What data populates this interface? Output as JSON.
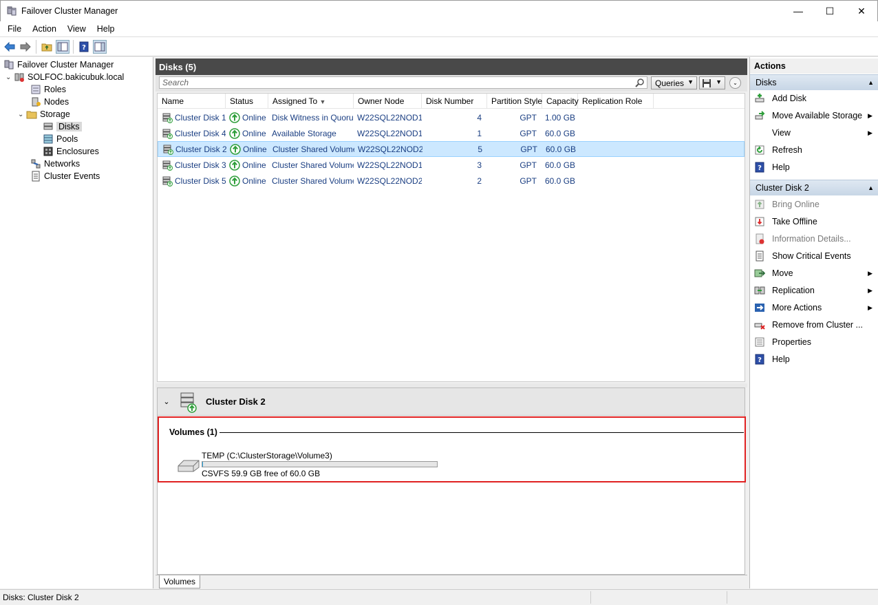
{
  "window": {
    "title": "Failover Cluster Manager",
    "minimize": "—",
    "maximize": "☐",
    "close": "✕"
  },
  "menu": [
    "File",
    "Action",
    "View",
    "Help"
  ],
  "tree": {
    "root": "Failover Cluster Manager",
    "cluster": "SOLFOC.bakicubuk.local",
    "roles": "Roles",
    "nodes": "Nodes",
    "storage": "Storage",
    "disks": "Disks",
    "pools": "Pools",
    "enclosures": "Enclosures",
    "networks": "Networks",
    "events": "Cluster Events"
  },
  "center": {
    "header": "Disks (5)",
    "search_placeholder": "Search",
    "queries": "Queries",
    "columns": [
      "Name",
      "Status",
      "Assigned To",
      "Owner Node",
      "Disk Number",
      "Partition Style",
      "Capacity",
      "Replication Role"
    ],
    "rows": [
      {
        "name": "Cluster Disk 1",
        "status": "Online",
        "assigned": "Disk Witness in Quorum",
        "owner": "W22SQL22NOD1",
        "number": "4",
        "style": "GPT",
        "capacity": "1.00 GB",
        "role": ""
      },
      {
        "name": "Cluster Disk 4",
        "status": "Online",
        "assigned": "Available Storage",
        "owner": "W22SQL22NOD1",
        "number": "1",
        "style": "GPT",
        "capacity": "60.0 GB",
        "role": ""
      },
      {
        "name": "Cluster Disk 2",
        "status": "Online",
        "assigned": "Cluster Shared Volume",
        "owner": "W22SQL22NOD2",
        "number": "5",
        "style": "GPT",
        "capacity": "60.0 GB",
        "role": ""
      },
      {
        "name": "Cluster Disk 3",
        "status": "Online",
        "assigned": "Cluster Shared Volume",
        "owner": "W22SQL22NOD1",
        "number": "3",
        "style": "GPT",
        "capacity": "60.0 GB",
        "role": ""
      },
      {
        "name": "Cluster Disk 5",
        "status": "Online",
        "assigned": "Cluster Shared Volume",
        "owner": "W22SQL22NOD2",
        "number": "2",
        "style": "GPT",
        "capacity": "60.0 GB",
        "role": ""
      }
    ],
    "selected_row": 2
  },
  "detail": {
    "title": "Cluster Disk 2",
    "volumes_title": "Volumes (1)",
    "volume_name": "TEMP (C:\\ClusterStorage\\Volume3)",
    "volume_free": "CSVFS 59.9 GB free of 60.0 GB",
    "used_fraction": 0.0017,
    "tab": "Volumes"
  },
  "actions": {
    "title": "Actions",
    "section1": "Disks",
    "items1": [
      "Add Disk",
      "Move Available Storage",
      "View",
      "Refresh",
      "Help"
    ],
    "section2": "Cluster Disk 2",
    "items2": [
      "Bring Online",
      "Take Offline",
      "Information Details...",
      "Show Critical Events",
      "Move",
      "Replication",
      "More Actions",
      "Remove from Cluster ...",
      "Properties",
      "Help"
    ]
  },
  "status": {
    "text": "Disks:  Cluster Disk 2"
  },
  "colors": {
    "online": "#2e9e3a",
    "selection": "#cce8ff",
    "highlight_box": "#e02020",
    "header": "#494949"
  }
}
